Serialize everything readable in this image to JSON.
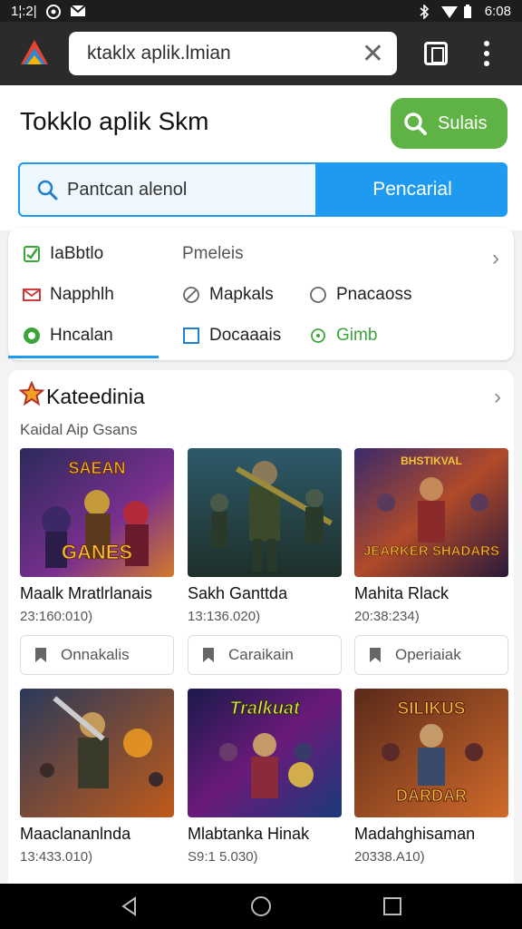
{
  "status_bar": {
    "time": "1¦:2|",
    "right_time": "6:08"
  },
  "browser": {
    "url_text": "ktaklx aplik.lmian"
  },
  "header": {
    "title": "Tokklo aplik Skm",
    "green_button_label": "Sulais",
    "search_placeholder": "Pantcan alenol",
    "search_button_label": "Pencarial"
  },
  "filters": {
    "items": [
      {
        "label": "IaBbtlo",
        "icon": "checkbox-checked-icon"
      },
      {
        "label": "Pmeleis",
        "icon": ""
      },
      {
        "label": "Napphlh",
        "icon": "mail-icon"
      },
      {
        "label": "Mapkals",
        "icon": "circle-slash-icon"
      },
      {
        "label": "Pnacaoss",
        "icon": "radio-icon"
      },
      {
        "label": "Hncalan",
        "icon": "chat-icon"
      },
      {
        "label": "Docaaais",
        "icon": "checkbox-icon"
      },
      {
        "label": "Gimb",
        "icon": "radio-green-icon"
      }
    ]
  },
  "categories": {
    "title": "Kateedinia",
    "subtitle": "Kaidal Aip Gsans",
    "games": [
      {
        "name": "Maalk Mratlrlanais",
        "meta": "23:160:010)",
        "thumb_text": "GANES",
        "thumb_top": "SAEAN"
      },
      {
        "name": "Sakh Ganttda",
        "meta": "13:136.020)",
        "thumb_text": "",
        "thumb_top": ""
      },
      {
        "name": "Mahita Rlack",
        "meta": "20:38:234)",
        "thumb_text": "JEARKER SHADARS",
        "thumb_top": "BHSTIKVAL"
      },
      {
        "name": "Maaclananlnda",
        "meta": "13:433.010)",
        "thumb_text": "",
        "thumb_top": ""
      },
      {
        "name": "Mlabtanka Hinak",
        "meta": "S9:1 5.030)",
        "thumb_text": "",
        "thumb_top": "Tralkuat"
      },
      {
        "name": "Madahghisaman",
        "meta": "20338.A10)",
        "thumb_text": "DARDAR",
        "thumb_top": "SILIKUS"
      }
    ],
    "buttons": [
      "Onnakalis",
      "Caraikain",
      "Operiaiak"
    ]
  },
  "colors": {
    "accent": "#1e9bf0",
    "green": "#5fb244"
  }
}
